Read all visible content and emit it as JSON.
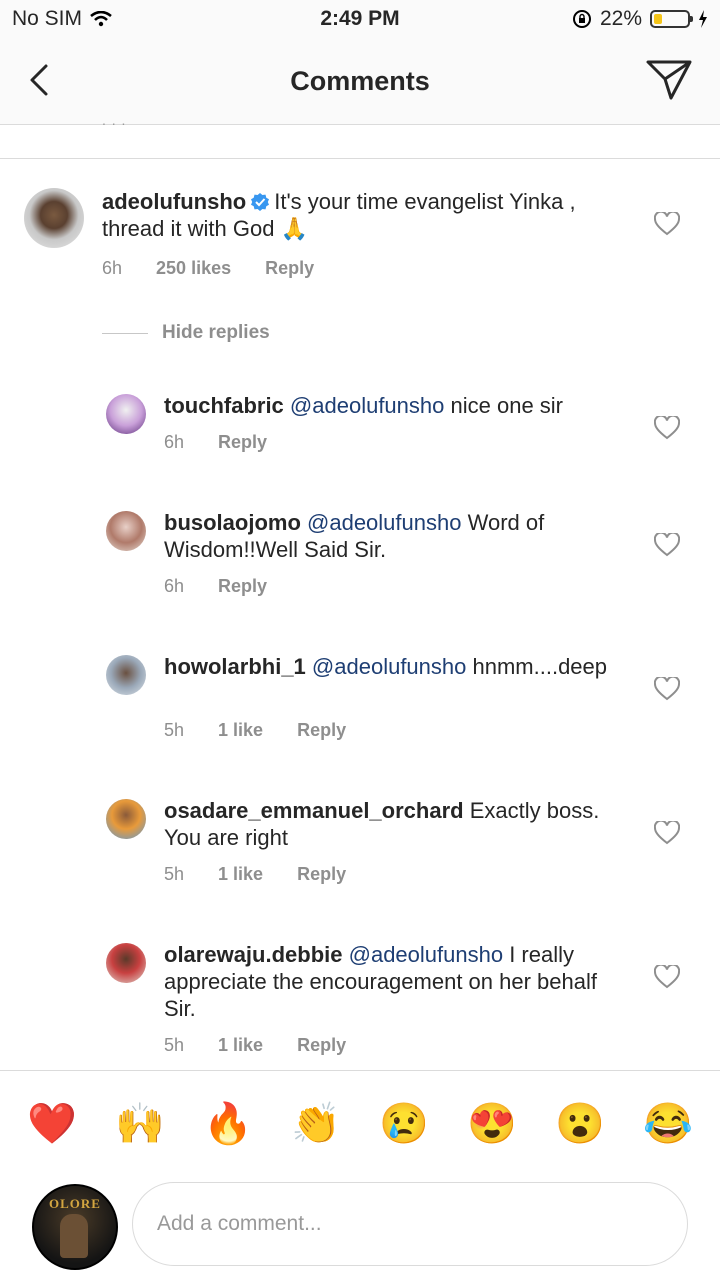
{
  "status": {
    "carrier": "No SIM",
    "time": "2:49 PM",
    "battery": "22%",
    "battery_level": 0.22
  },
  "nav": {
    "title": "Comments",
    "back_icon": "chevron-left-icon",
    "share_icon": "send-icon"
  },
  "parent_comment": {
    "username": "adeolufunsho",
    "verified": true,
    "text": "It's your time evangelist Yinka , thread it with God 🙏",
    "time": "6h",
    "likes": "250 likes",
    "reply": "Reply"
  },
  "hide_replies": "Hide replies",
  "replies": [
    {
      "username": "touchfabric",
      "mention": "@adeolufunsho",
      "text": "nice one sir",
      "time": "6h",
      "likes": "",
      "reply": "Reply"
    },
    {
      "username": "busolaojomo",
      "mention": "@adeolufunsho",
      "text": "Word of Wisdom!!Well Said Sir.",
      "time": "6h",
      "likes": "",
      "reply": "Reply"
    },
    {
      "username": "howolarbhi_1",
      "mention": "@adeolufunsho",
      "text": "hnmm....deep",
      "time": "5h",
      "likes": "1 like",
      "reply": "Reply"
    },
    {
      "username": "osadare_emmanuel_orchard",
      "mention": "",
      "text": "Exactly boss. You are right",
      "time": "5h",
      "likes": "1 like",
      "reply": "Reply"
    },
    {
      "username": "olarewaju.debbie",
      "mention": "@adeolufunsho",
      "text": "I really appreciate the encouragement on her behalf Sir.",
      "time": "5h",
      "likes": "1 like",
      "reply": "Reply"
    }
  ],
  "emoji_bar": [
    "❤️",
    "🙌",
    "🔥",
    "👏",
    "😢",
    "😍",
    "😮",
    "😂"
  ],
  "composer": {
    "placeholder": "Add a comment...",
    "avatar_text": "OLORE"
  },
  "colors": {
    "mention": "#1e3e73",
    "verified": "#3897f0",
    "meta": "#8e8e8e"
  }
}
